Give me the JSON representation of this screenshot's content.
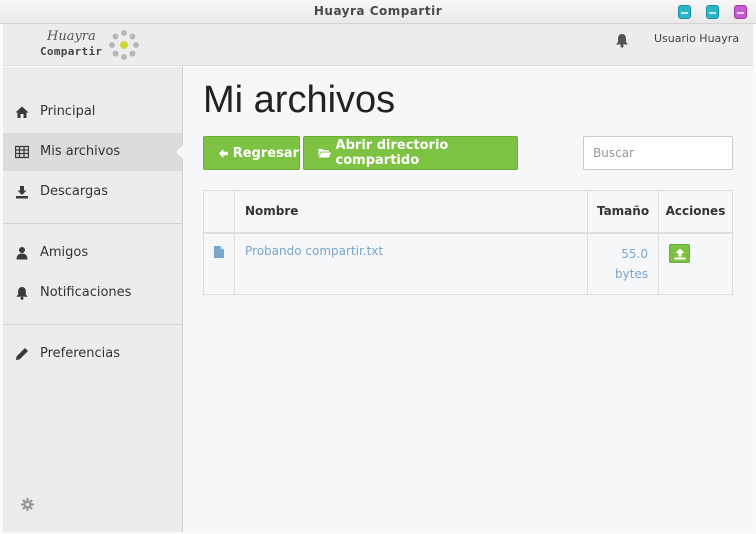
{
  "window": {
    "title": "Huayra Compartir"
  },
  "header": {
    "logo_line1": "Huayra",
    "logo_line2": "Compartir",
    "user_name": "Usuario Huayra"
  },
  "sidebar": {
    "items": [
      {
        "label": "Principal",
        "icon": "home-icon"
      },
      {
        "label": "Mis archivos",
        "icon": "table-icon",
        "active": true
      },
      {
        "label": "Descargas",
        "icon": "download-icon"
      },
      {
        "label": "Amigos",
        "icon": "user-icon"
      },
      {
        "label": "Notificaciones",
        "icon": "bell-icon"
      },
      {
        "label": "Preferencias",
        "icon": "pencil-icon"
      }
    ]
  },
  "main": {
    "title": "Mi archivos",
    "back_label": "Regresar",
    "open_dir_label": "Abrir directorio compartido",
    "search_placeholder": "Buscar",
    "table": {
      "headers": {
        "name": "Nombre",
        "size": "Tamaño",
        "actions": "Acciones"
      },
      "rows": [
        {
          "name": "Probando compartir.txt",
          "size_value": "55.0",
          "size_unit": "bytes"
        }
      ]
    }
  },
  "colors": {
    "accent_green": "#7dc242",
    "link_blue": "#7aa5cc"
  }
}
